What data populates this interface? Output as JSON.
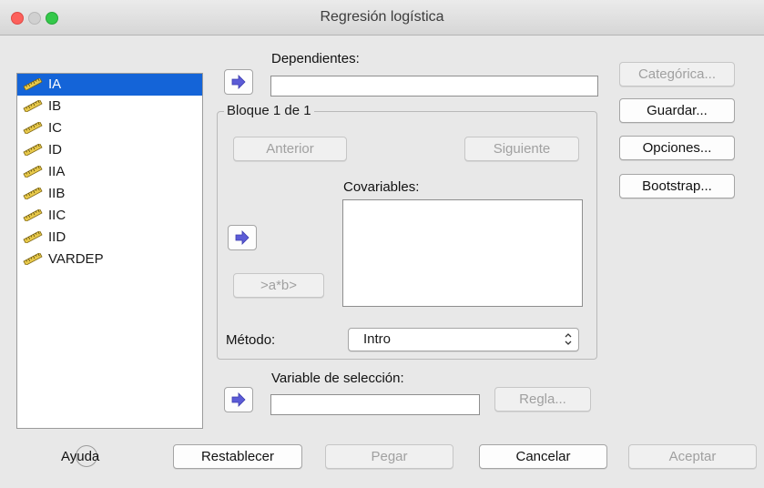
{
  "window": {
    "title": "Regresión logística"
  },
  "variables": {
    "items": [
      "IA",
      "IB",
      "IC",
      "ID",
      "IIA",
      "IIB",
      "IIC",
      "IID",
      "VARDEP"
    ],
    "selected": "IA"
  },
  "dependientes": {
    "label": "Dependientes:",
    "value": ""
  },
  "block": {
    "title": "Bloque 1 de 1",
    "prev_label": "Anterior",
    "next_label": "Siguiente",
    "covariables_label": "Covariables:",
    "interaction_label": ">a*b>"
  },
  "method": {
    "label": "Método:",
    "value": "Intro"
  },
  "selection": {
    "label": "Variable de selección:",
    "value": "",
    "rule_label": "Regla..."
  },
  "side_buttons": {
    "categorica": "Categórica...",
    "guardar": "Guardar...",
    "opciones": "Opciones...",
    "bootstrap": "Bootstrap..."
  },
  "bottom": {
    "help": "Ayuda",
    "reset": "Restablecer",
    "paste": "Pegar",
    "cancel": "Cancelar",
    "ok": "Aceptar"
  },
  "colors": {
    "selection": "#1464d8",
    "arrow_icon": "#5b5bd6"
  }
}
